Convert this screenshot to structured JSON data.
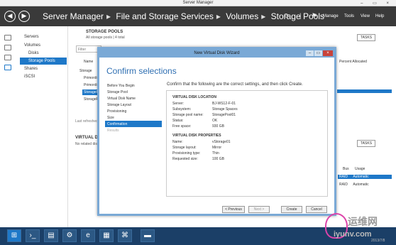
{
  "window": {
    "title": "Server Manager",
    "controls": "– ▭ ×"
  },
  "header": {
    "breadcrumb": [
      "Server Manager",
      "File and Storage Services",
      "Volumes",
      "Storage Pools"
    ],
    "menu": [
      "Manage",
      "Tools",
      "View",
      "Help"
    ]
  },
  "nav": {
    "items": [
      "Servers",
      "Volumes",
      "Disks",
      "Storage Pools",
      "Shares",
      "iSCSI"
    ]
  },
  "storage_pools": {
    "title": "STORAGE POOLS",
    "subtitle": "All storage pools | 4 total",
    "tasks": "TASKS",
    "filter_placeholder": "Filter",
    "columns": {
      "name": "Name",
      "percent": "Percent Allocated"
    },
    "group": "Storage",
    "rows": [
      "Primordi",
      "Primordi",
      "StorageP",
      "StorageP"
    ],
    "last_refreshed": "Last refreshed"
  },
  "virtual_disks": {
    "title": "VIRTUAL DISK",
    "subtitle": "No related disk",
    "tasks": "TASKS",
    "columns": {
      "bus": "Bus",
      "usage": "Usage"
    },
    "rows": [
      {
        "bus": "RAID",
        "usage": "Automatic"
      },
      {
        "bus": "RAID",
        "usage": "Automatic"
      }
    ]
  },
  "wizard": {
    "title": "New Virtual Disk Wizard",
    "heading": "Confirm selections",
    "lead": "Confirm that the following are the correct settings, and then click Create.",
    "steps": [
      "Before You Begin",
      "Storage Pool",
      "Virtual Disk Name",
      "Storage Layout",
      "Provisioning",
      "Size",
      "Confirmation",
      "Results"
    ],
    "location_title": "VIRTUAL DISK LOCATION",
    "location": [
      {
        "k": "Server:",
        "v": "BJ-WS12-F-01"
      },
      {
        "k": "Subsystem:",
        "v": "Storage Spaces"
      },
      {
        "k": "Storage pool name:",
        "v": "StoragePool01"
      },
      {
        "k": "Status:",
        "v": "OK"
      },
      {
        "k": "Free space:",
        "v": "930 GB"
      }
    ],
    "properties_title": "VIRTUAL DISK PROPERTIES",
    "properties": [
      {
        "k": "Name:",
        "v": "vStorage01"
      },
      {
        "k": "Storage layout:",
        "v": "Mirror"
      },
      {
        "k": "Provisioning type:",
        "v": "Thin"
      },
      {
        "k": "Requested size:",
        "v": "100 GB"
      }
    ],
    "buttons": {
      "previous": "< Previous",
      "next": "Next >",
      "create": "Create",
      "cancel": "Cancel"
    }
  },
  "watermark": {
    "cn": "运维网",
    "site": "iyunv.com"
  },
  "clock": "2013/7/8",
  "colors": {
    "accent": "#1e78c8",
    "header_bg": "#3a3a3a",
    "wizard_frame": "#7aa9d6"
  }
}
